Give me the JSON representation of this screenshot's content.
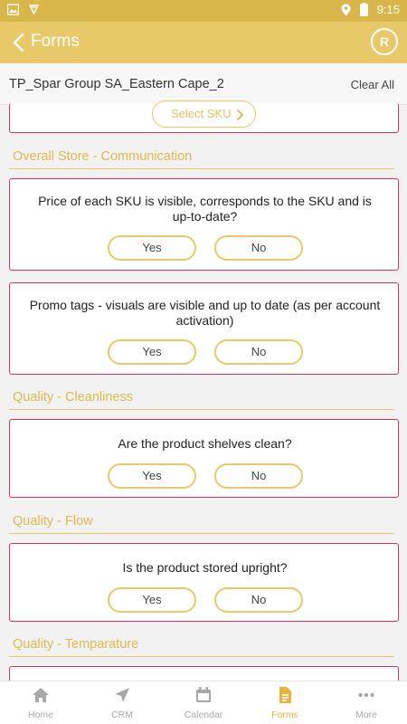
{
  "statusbar": {
    "time": "9:15"
  },
  "header": {
    "title": "Forms",
    "avatar_initial": "R"
  },
  "subheader": {
    "store_name": "TP_Spar Group SA_Eastern Cape_2",
    "clear_all": "Clear All"
  },
  "select_sku": {
    "label": "Select SKU"
  },
  "sections": [
    {
      "title": "Overall Store - Communication"
    },
    {
      "title": "Quality - Cleanliness"
    },
    {
      "title": "Quality - Flow"
    },
    {
      "title": "Quality - Temparature"
    }
  ],
  "questions": [
    {
      "text": "Price of each SKU is visible, corresponds to the SKU and is up-to-date?",
      "yes": "Yes",
      "no": "No"
    },
    {
      "text": "Promo tags - visuals are visible and up to date (as per account activation)",
      "yes": "Yes",
      "no": "No"
    },
    {
      "text": "Are the product shelves clean?",
      "yes": "Yes",
      "no": "No"
    },
    {
      "text": "Is the product stored upright?",
      "yes": "Yes",
      "no": "No"
    }
  ],
  "nav": [
    {
      "label": "Home",
      "icon": "home-icon"
    },
    {
      "label": "CRM",
      "icon": "navigation-arrow-icon"
    },
    {
      "label": "Calendar",
      "icon": "calendar-icon"
    },
    {
      "label": "Forms",
      "icon": "document-icon",
      "active": true
    },
    {
      "label": "More",
      "icon": "more-dots-icon"
    }
  ],
  "colors": {
    "accent": "#e8c868",
    "statusbar": "#d8b64a",
    "card_border": "#d9325b",
    "section_title": "#e0b84c",
    "nav_active": "#e8b43c"
  }
}
